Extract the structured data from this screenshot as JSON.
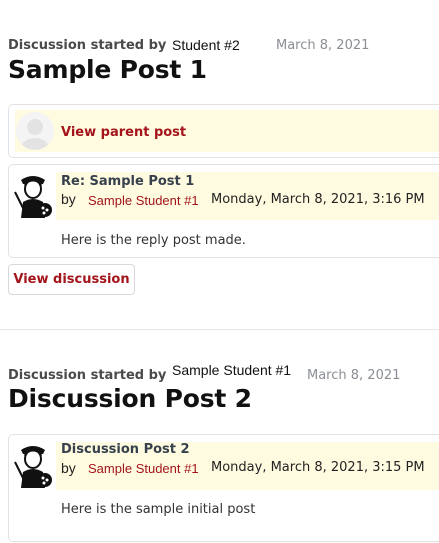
{
  "post1": {
    "started_by_label": "Discussion started by",
    "author": "Student  #2",
    "date": "March 8, 2021",
    "title": "Sample Post 1",
    "parent_link": "View parent post",
    "reply": {
      "title": "Re: Sample Post 1",
      "by": "by",
      "author": "Sample Student #1",
      "timestamp": "Monday, March 8, 2021, 3:16 PM",
      "message": "Here is the reply post made."
    },
    "view_discussion": "View discussion"
  },
  "post2": {
    "started_by_label": "Discussion started by",
    "author": "Sample Student  #1",
    "date": "March 8, 2021",
    "title": "Discussion Post 2",
    "reply": {
      "title": "Discussion Post 2",
      "by": "by",
      "author": "Sample Student #1",
      "timestamp": "Monday, March 8, 2021, 3:15 PM",
      "message": "Here is the sample initial post"
    }
  },
  "icons": {
    "default_avatar": "default-user-avatar-icon",
    "student_avatar": "student-artist-avatar-icon"
  },
  "colors": {
    "link_red": "#a3141b",
    "highlight_yellow": "#fffbe0"
  }
}
